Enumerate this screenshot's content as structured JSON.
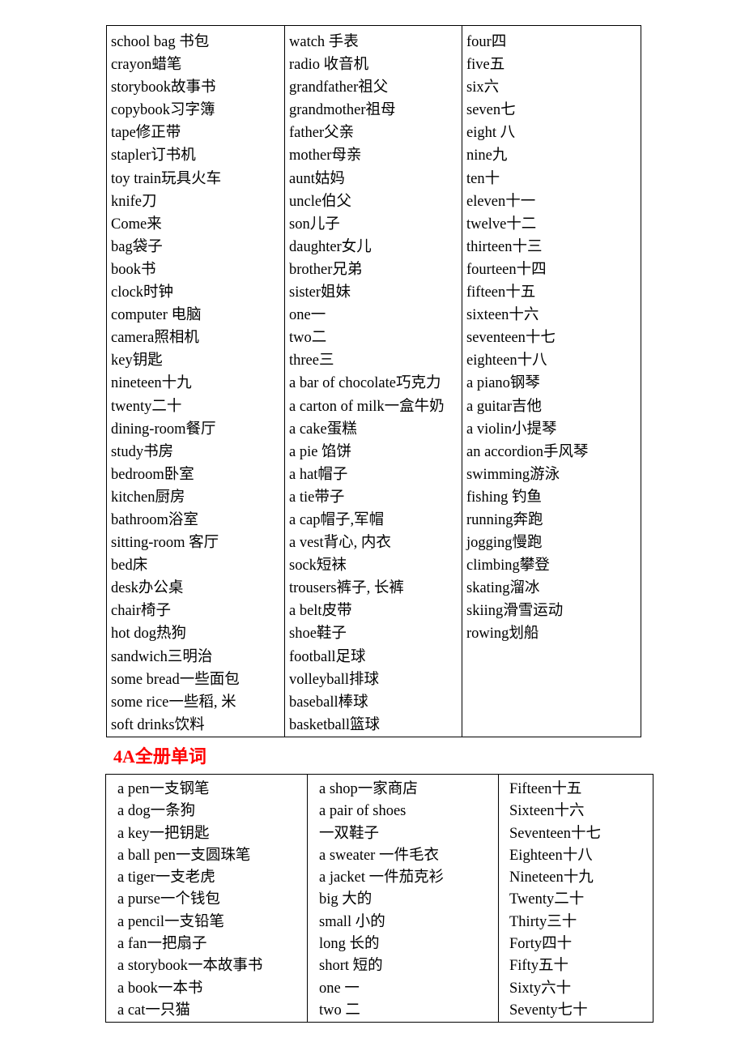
{
  "document": {
    "heading_red": "4A全册单词",
    "heading_color": "#FF0000"
  },
  "table1": {
    "columns": [
      {
        "name": "column-1",
        "items": [
          "school bag 书包",
          "crayon蜡笔",
          "storybook故事书",
          "copybook习字簿",
          "tape修正带",
          "stapler订书机",
          "toy train玩具火车",
          "knife刀",
          "Come来",
          "bag袋子",
          "book书",
          "clock时钟",
          "computer 电脑",
          "camera照相机",
          "key钥匙",
          "nineteen十九",
          "twenty二十",
          "dining-room餐厅",
          "study书房",
          "bedroom卧室",
          "kitchen厨房",
          "bathroom浴室",
          "sitting-room 客厅",
          "bed床",
          "desk办公桌",
          "chair椅子",
          "hot dog热狗",
          "sandwich三明治",
          "some bread一些面包",
          "some rice一些稻, 米",
          "soft drinks饮料"
        ]
      },
      {
        "name": "column-2",
        "items": [
          "watch 手表",
          "radio 收音机",
          "grandfather祖父",
          "grandmother祖母",
          "father父亲",
          "mother母亲",
          "aunt姑妈",
          "uncle伯父",
          "son儿子",
          "daughter女儿",
          "brother兄弟",
          "sister姐妹",
          "one一",
          "two二",
          "three三",
          "a bar of chocolate巧克力",
          "a carton of milk一盒牛奶",
          "a cake蛋糕",
          "a pie 馅饼",
          "a hat帽子",
          "a tie带子",
          "a cap帽子,军帽",
          "a vest背心, 内衣",
          "sock短袜",
          "trousers裤子, 长裤",
          "a belt皮带",
          "shoe鞋子",
          "football足球",
          "volleyball排球",
          "baseball棒球",
          "basketball篮球"
        ]
      },
      {
        "name": "column-3",
        "items": [
          "four四",
          "five五",
          "six六",
          "seven七",
          "eight 八",
          "nine九",
          "ten十",
          "eleven十一",
          "twelve十二",
          "thirteen十三",
          "fourteen十四",
          "fifteen十五",
          "sixteen十六",
          "seventeen十七",
          "eighteen十八",
          "a piano钢琴",
          "a guitar吉他",
          "a violin小提琴",
          "an accordion手风琴",
          "swimming游泳",
          "fishing 钓鱼",
          "running奔跑",
          "jogging慢跑",
          "climbing攀登",
          "skating溜冰",
          "skiing滑雪运动",
          "rowing划船"
        ]
      }
    ]
  },
  "table2": {
    "columns": [
      {
        "name": "column-1",
        "items": [
          "a pen一支钢笔",
          "a dog一条狗",
          "a key一把钥匙",
          "a ball pen一支圆珠笔",
          "a tiger一支老虎",
          "a purse一个钱包",
          "a pencil一支铅笔",
          "a fan一把扇子",
          "a storybook一本故事书",
          "a book一本书",
          "a cat一只猫"
        ]
      },
      {
        "name": "column-2",
        "items": [
          "a shop一家商店",
          "a pair of shoes",
          "一双鞋子",
          "a sweater 一件毛衣",
          "a jacket 一件茄克衫",
          "big 大的",
          "small 小的",
          "long 长的",
          "short 短的",
          "one 一",
          "two 二"
        ]
      },
      {
        "name": "column-3",
        "items": [
          "Fifteen十五",
          "Sixteen十六",
          "Seventeen十七",
          "Eighteen十八",
          "Nineteen十九",
          "Twenty二十",
          "Thirty三十",
          "Forty四十",
          "Fifty五十",
          "Sixty六十",
          "Seventy七十"
        ]
      }
    ]
  }
}
